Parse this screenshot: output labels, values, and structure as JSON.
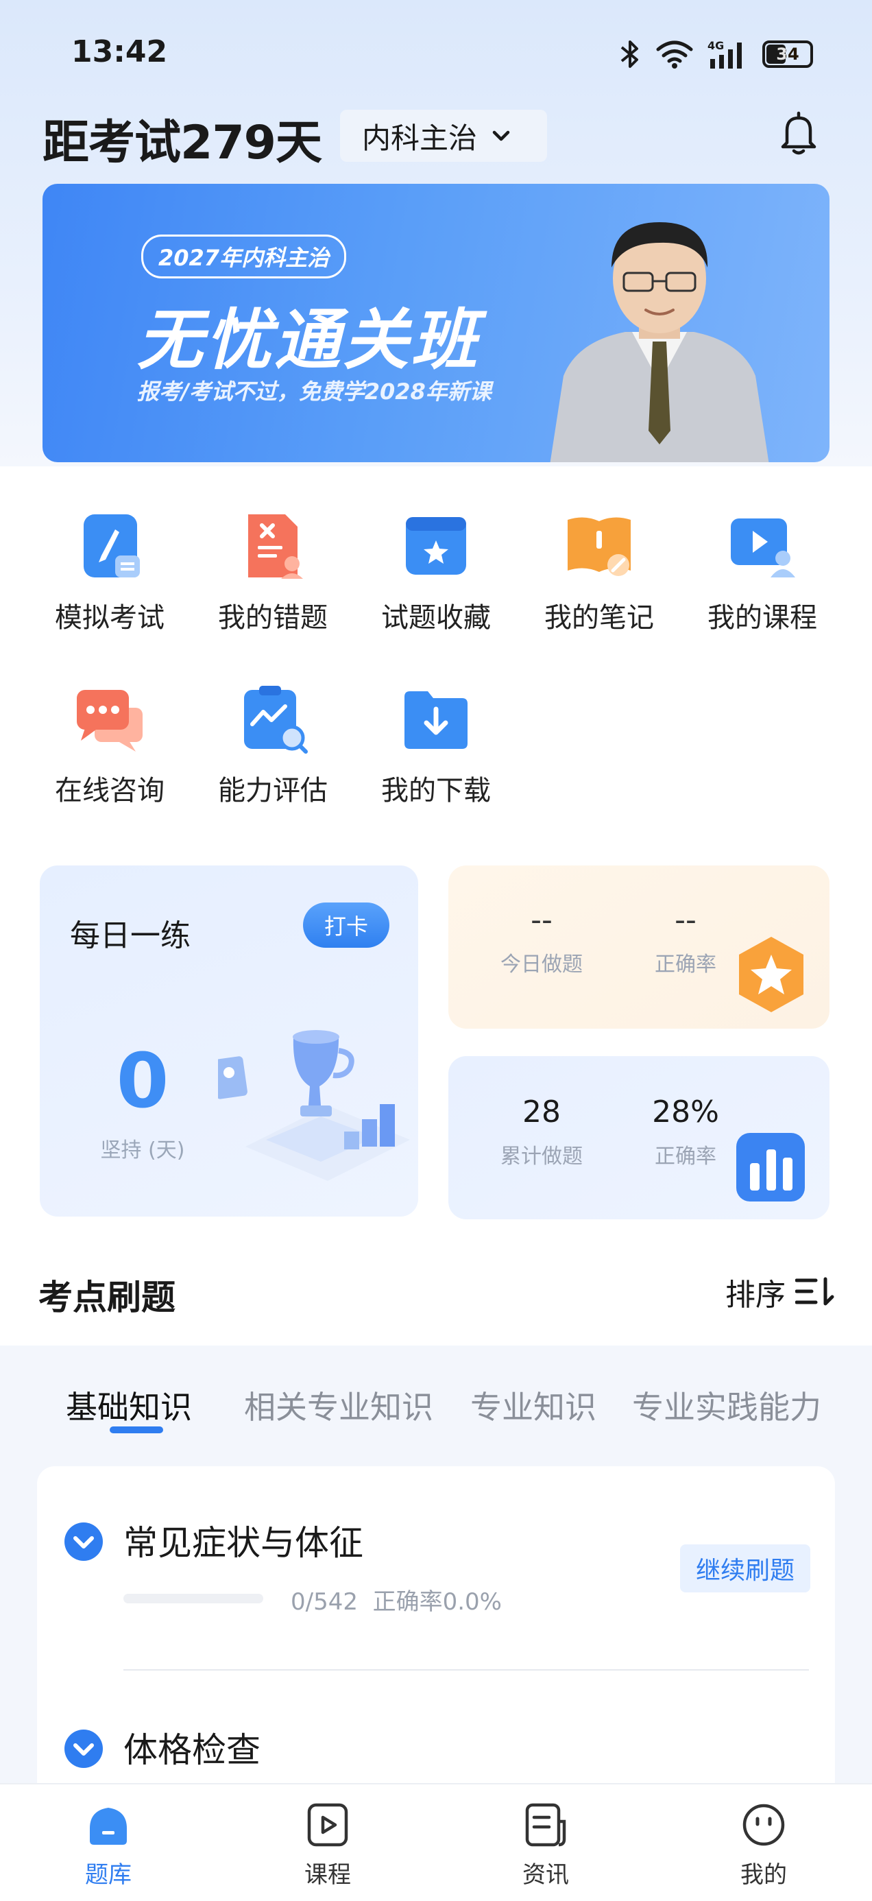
{
  "status_bar": {
    "time": "13:42",
    "battery": "34",
    "network": "4G"
  },
  "header": {
    "countdown": "距考试279天",
    "subject": "内科主治",
    "icons": [
      "chevron-down-icon",
      "bell-icon"
    ]
  },
  "banner": {
    "tag": "2027年内科主治",
    "title": "无忧通关班",
    "subtitle": "报考/考试不过，免费学2028年新课"
  },
  "functions": [
    {
      "label": "模拟考试",
      "icon": "mock-exam-icon"
    },
    {
      "label": "我的错题",
      "icon": "wrong-questions-icon"
    },
    {
      "label": "试题收藏",
      "icon": "favorites-icon"
    },
    {
      "label": "我的笔记",
      "icon": "notes-icon"
    },
    {
      "label": "我的课程",
      "icon": "courses-icon"
    },
    {
      "label": "在线咨询",
      "icon": "consult-icon"
    },
    {
      "label": "能力评估",
      "icon": "assessment-icon"
    },
    {
      "label": "我的下载",
      "icon": "download-icon"
    }
  ],
  "daily": {
    "title": "每日一练",
    "checkin": "打卡",
    "streak_value": "0",
    "streak_label": "坚持 (天)"
  },
  "today_stats": {
    "done_value": "--",
    "done_label": "今日做题",
    "accuracy_value": "--",
    "accuracy_label": "正确率"
  },
  "total_stats": {
    "done_value": "28",
    "done_label": "累计做题",
    "accuracy_value": "28%",
    "accuracy_label": "正确率"
  },
  "section": {
    "title": "考点刷题",
    "sort_label": "排序"
  },
  "tabs": [
    "基础知识",
    "相关专业知识",
    "专业知识",
    "专业实践能力"
  ],
  "active_tab": "基础知识",
  "topics": [
    {
      "title": "常见症状与体征",
      "progress_text": "0/542",
      "accuracy_text": "正确率0.0%",
      "progress_fraction": 0,
      "action": "继续刷题"
    },
    {
      "title": "体格检查"
    }
  ],
  "bottom_nav": [
    {
      "label": "题库",
      "icon": "question-bank-icon",
      "active": true
    },
    {
      "label": "课程",
      "icon": "course-play-icon",
      "active": false
    },
    {
      "label": "资讯",
      "icon": "news-icon",
      "active": false
    },
    {
      "label": "我的",
      "icon": "profile-icon",
      "active": false
    }
  ],
  "colors": {
    "accent": "#2f7df0",
    "banner": "#4a90f6",
    "daily_card": "#e9f1ff",
    "today_card": "#fff4e8"
  }
}
